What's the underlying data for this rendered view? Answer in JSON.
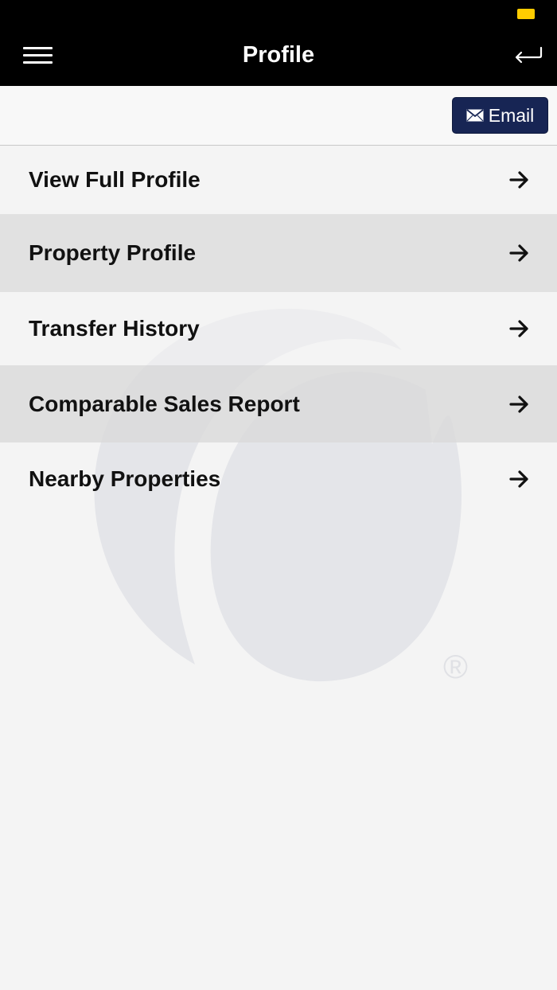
{
  "header": {
    "title": "Profile",
    "menu_icon": "hamburger-menu-icon",
    "back_icon": "return-arrow-icon"
  },
  "status_bar": {
    "battery_color": "#ffcc00"
  },
  "toolbar": {
    "email_label": "Email",
    "email_icon": "envelope-icon",
    "email_color": "#172554"
  },
  "menu": {
    "items": [
      {
        "label": "View Full Profile",
        "icon": "arrow-right-icon"
      },
      {
        "label": "Property Profile",
        "icon": "arrow-right-icon"
      },
      {
        "label": "Transfer History",
        "icon": "arrow-right-icon"
      },
      {
        "label": "Comparable Sales Report",
        "icon": "arrow-right-icon"
      },
      {
        "label": "Nearby Properties",
        "icon": "arrow-right-icon"
      }
    ]
  },
  "watermark": {
    "registered_mark": "®"
  }
}
